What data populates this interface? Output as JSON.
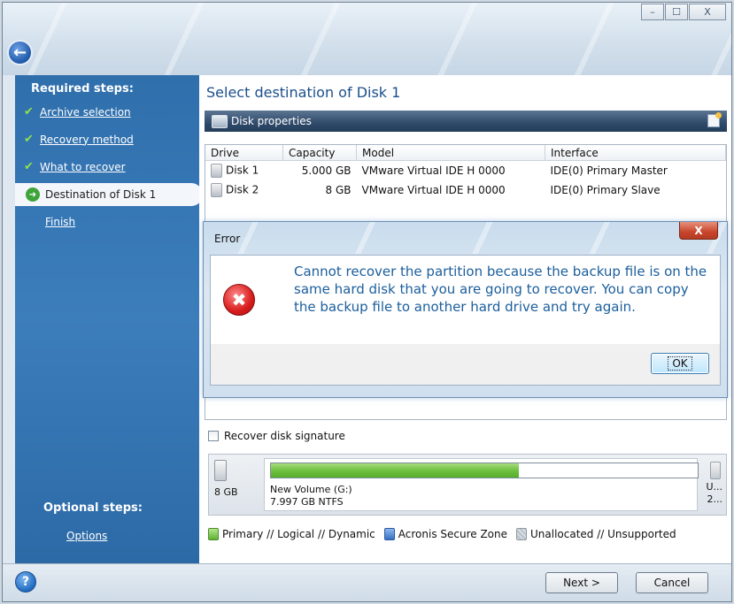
{
  "window": {
    "controls": {
      "minimize": "–",
      "maximize": "☐",
      "close": "X"
    }
  },
  "sidebar": {
    "required_header": "Required steps:",
    "steps": [
      {
        "label": "Archive selection",
        "state": "done"
      },
      {
        "label": "Recovery method",
        "state": "done"
      },
      {
        "label": "What to recover",
        "state": "done"
      },
      {
        "label": "Destination of Disk 1",
        "state": "current"
      },
      {
        "label": "Finish",
        "state": "pending"
      }
    ],
    "optional_header": "Optional steps:",
    "optional_link": "Options"
  },
  "main": {
    "title": "Select destination of Disk 1",
    "properties_label": "Disk properties",
    "table": {
      "columns": [
        "Drive",
        "Capacity",
        "Model",
        "Interface"
      ],
      "rows": [
        {
          "drive": "Disk 1",
          "capacity": "5.000 GB",
          "model": "VMware Virtual IDE H 0000",
          "interface": "IDE(0) Primary Master"
        },
        {
          "drive": "Disk 2",
          "capacity": "8 GB",
          "model": "VMware Virtual IDE H 0000",
          "interface": "IDE(0) Primary Slave"
        }
      ]
    },
    "recover_signature_label": "Recover disk signature",
    "volume": {
      "disk_size": "8 GB",
      "name": "New Volume (G:)",
      "info": "7.997 GB  NTFS",
      "used_fraction": 0.58,
      "second_label_a": "U...",
      "second_label_b": "2..."
    },
    "legend": {
      "primary": "Primary // Logical // Dynamic",
      "acronis": "Acronis Secure Zone",
      "unallocated": "Unallocated // Unsupported"
    }
  },
  "dialog": {
    "title": "Error",
    "close": "X",
    "message": "Cannot recover the partition because the backup file is on the same hard disk that you are going to recover. You can copy the backup file to another hard drive and try again.",
    "ok": "OK"
  },
  "footer": {
    "help": "?",
    "next": "Next >",
    "cancel": "Cancel"
  },
  "colors": {
    "sidebar": "#3a7bbb",
    "accent_title": "#1b4f8c",
    "error_text": "#1b5e9c",
    "volume_fill": "#6abf3c"
  }
}
